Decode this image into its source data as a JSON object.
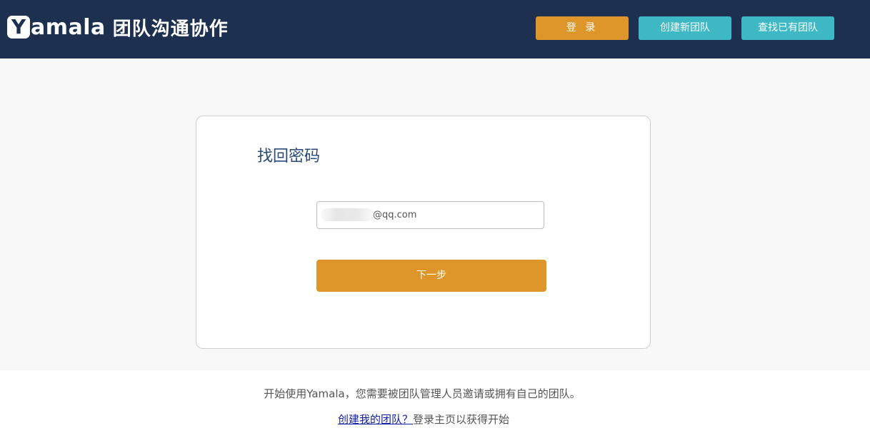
{
  "header": {
    "logo_letter": "Y",
    "logo_word": "amala",
    "tagline": "团队沟通协作",
    "login_label": "登 录",
    "create_team_label": "创建新团队",
    "find_team_label": "查找已有团队"
  },
  "card": {
    "title": "找回密码",
    "email_value": "@qq.com",
    "next_label": "下一步"
  },
  "footer": {
    "intro": "开始使用Yamala，您需要被团队管理人员邀请或拥有自己的团队。",
    "create_link": "创建我的团队？",
    "suffix": "登录主页以获得开始"
  },
  "colors": {
    "header_bg": "#1e3050",
    "accent_orange": "#de962b",
    "accent_teal": "#3db8c4",
    "title_blue": "#2a4a78"
  }
}
